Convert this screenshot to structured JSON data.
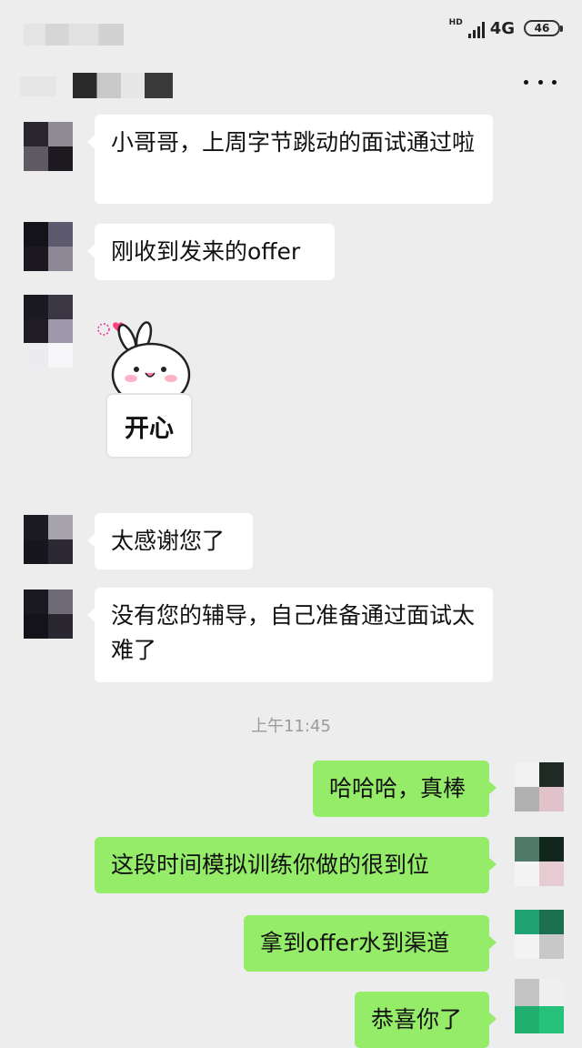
{
  "status_bar": {
    "hd": "HD",
    "network": "4G",
    "battery": "46"
  },
  "header": {
    "more_icon": "more-dots-icon"
  },
  "messages": [
    {
      "side": "in",
      "text": "小哥哥，上周字节跳动的面试通过啦"
    },
    {
      "side": "in",
      "text": "刚收到发来的offer"
    },
    {
      "side": "in",
      "type": "sticker",
      "text": "开心"
    },
    {
      "side": "in",
      "text": "太感谢您了"
    },
    {
      "side": "in",
      "text": "没有您的辅导，自己准备通过面试太难了"
    }
  ],
  "timestamp": "上午11:45",
  "replies": [
    {
      "side": "out",
      "text": "哈哈哈，真棒"
    },
    {
      "side": "out",
      "text": "这段时间模拟训练你做的很到位"
    },
    {
      "side": "out",
      "text": "拿到offer水到渠道"
    },
    {
      "side": "out",
      "text": "恭喜你了"
    }
  ],
  "colors": {
    "outgoing_bubble": "#95ec69",
    "incoming_bubble": "#ffffff",
    "background": "#ededed"
  }
}
